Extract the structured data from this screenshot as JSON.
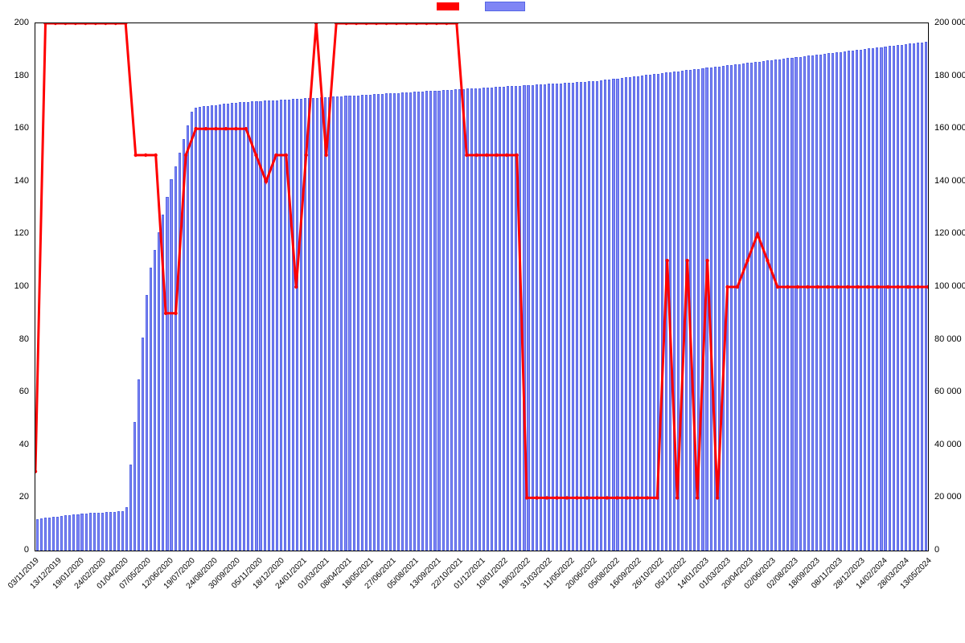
{
  "chart_data": {
    "type": "combo-bar-line",
    "title": "",
    "x_dates": [
      "03/11/2019",
      "13/12/2019",
      "19/01/2020",
      "24/02/2020",
      "01/04/2020",
      "07/05/2020",
      "12/06/2020",
      "19/07/2020",
      "24/08/2020",
      "30/09/2020",
      "05/11/2020",
      "18/12/2020",
      "24/01/2021",
      "01/03/2021",
      "08/04/2021",
      "18/05/2021",
      "27/06/2021",
      "05/08/2021",
      "13/09/2021",
      "22/10/2021",
      "01/12/2021",
      "10/01/2022",
      "19/02/2022",
      "31/03/2022",
      "11/05/2022",
      "20/06/2022",
      "05/08/2022",
      "16/09/2022",
      "26/10/2022",
      "05/12/2022",
      "14/01/2023",
      "01/03/2023",
      "20/04/2023",
      "02/06/2023",
      "02/08/2023",
      "18/09/2023",
      "08/11/2023",
      "28/12/2023",
      "14/02/2024",
      "28/03/2024",
      "13/05/2024"
    ],
    "left_axis": {
      "label": "",
      "min": 0,
      "max": 200,
      "ticks": [
        0,
        20,
        40,
        60,
        80,
        100,
        120,
        140,
        160,
        180,
        200
      ]
    },
    "right_axis": {
      "label": "",
      "min": 0,
      "max": 200000,
      "ticks": [
        0,
        20000,
        40000,
        60000,
        80000,
        100000,
        120000,
        140000,
        160000,
        180000,
        200000
      ]
    },
    "right_tick_labels": [
      "0",
      "20 000",
      "40 000",
      "60 000",
      "80 000",
      "100 000",
      "120 000",
      "140 000",
      "160 000",
      "180 000",
      "200 000"
    ],
    "series": [
      {
        "name": "",
        "type": "line",
        "axis": "left",
        "color": "#ff0000",
        "values": [
          30,
          200,
          200,
          200,
          200,
          200,
          200,
          200,
          200,
          200,
          150,
          150,
          150,
          90,
          90,
          150,
          160,
          160,
          160,
          160,
          160,
          160,
          150,
          140,
          150,
          150,
          100,
          150,
          200,
          150,
          200,
          200,
          200,
          200,
          200,
          200,
          200,
          200,
          200,
          200,
          200,
          200,
          200,
          150,
          150,
          150,
          150,
          150,
          150,
          20,
          20,
          20,
          20,
          20,
          20,
          20,
          20,
          20,
          20,
          20,
          20,
          20,
          20,
          110,
          20,
          110,
          20,
          110,
          20,
          100,
          100,
          110,
          120,
          110,
          100,
          100,
          100,
          100,
          100,
          100,
          100,
          100,
          100,
          100,
          100,
          100,
          100,
          100,
          100,
          100
        ]
      },
      {
        "name": "",
        "type": "bar",
        "axis": "right",
        "color": "#7f85f5",
        "values_sampled_at_ticks": [
          12000,
          13000,
          14000,
          14500,
          15000,
          103000,
          140000,
          168000,
          169000,
          170000,
          170500,
          171000,
          171500,
          172000,
          172500,
          173000,
          173500,
          174000,
          174500,
          175000,
          175500,
          176000,
          176500,
          177000,
          177500,
          178000,
          179000,
          180000,
          181000,
          182000,
          183000,
          184000,
          185000,
          186000,
          187000,
          188000,
          189000,
          190000,
          191000,
          192000,
          193000
        ]
      }
    ],
    "n_bars_approx": 220,
    "bars_values": []
  }
}
